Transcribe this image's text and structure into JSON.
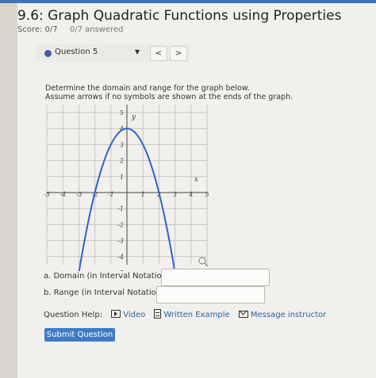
{
  "header": {
    "title": "9.6: Graph Quadratic Functions using Properties",
    "score": "Score: 0/7",
    "answered": "0/7 answered"
  },
  "question_nav": {
    "label": "Question 5",
    "dropdown_glyph": "▼",
    "prev_glyph": "<",
    "next_glyph": ">"
  },
  "prompt": {
    "line1": "Determine the domain and range for the graph below.",
    "line2": "Assume arrows if no symbols are shown at the ends of the graph."
  },
  "graph": {
    "x_label": "x",
    "y_label": "y",
    "x_ticks": [
      "-5",
      "-4",
      "-3",
      "-2",
      "-1",
      "1",
      "2",
      "3",
      "4",
      "5"
    ],
    "y_ticks": [
      "5",
      "4",
      "3",
      "2",
      "1",
      "-1",
      "-2",
      "-3",
      "-4",
      "-5"
    ],
    "curve": {
      "a": -1,
      "h": 0,
      "k": 4,
      "x_start": -3,
      "x_end": 3
    }
  },
  "fields": {
    "domain_label": "a. Domain (in Interval Notation):",
    "domain_value": "",
    "range_label": "b. Range (in Interval Notation):",
    "range_value": ""
  },
  "help": {
    "label": "Question Help:",
    "video": "Video",
    "written_example": "Written Example",
    "message": "Message instructor"
  },
  "submit_label": "Submit Question",
  "colors": {
    "accent": "#3f7bc4",
    "curve": "#2f63c8",
    "nav_dot": "#3c5ea8"
  }
}
